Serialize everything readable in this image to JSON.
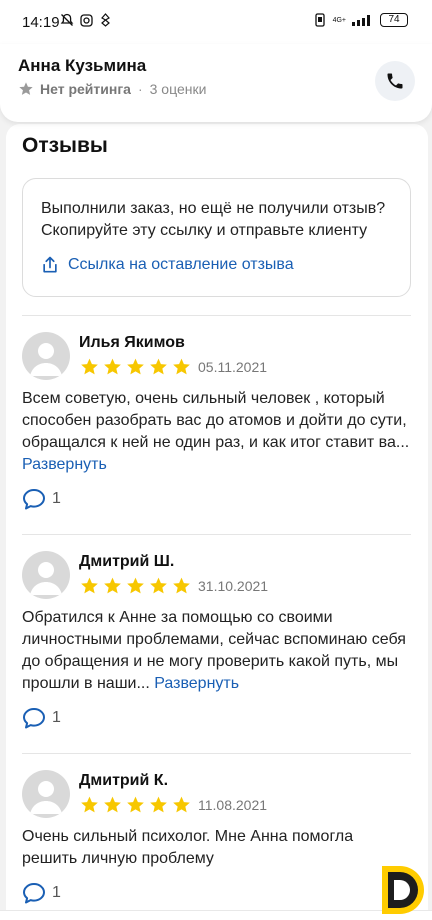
{
  "status": {
    "time": "14:19",
    "network": "4G+",
    "battery": "74"
  },
  "header": {
    "name": "Анна Кузьмина",
    "rating": "Нет рейтинга",
    "separator": "·",
    "reviews_count": "3 оценки"
  },
  "reviews_section": {
    "title": "Отзывы",
    "info_text": "Выполнили заказ, но ещё не получили отзыв? Скопируйте эту ссылку и отправьте клиенту",
    "link_label": "Ссылка на оставление отзыва"
  },
  "reviews": [
    {
      "author": "Илья Якимов",
      "stars": 5,
      "date": "05.11.2021",
      "text": "Всем советую, очень сильный человек , который способен разобрать вас до атомов и дойти до сути, обращался к ней не один раз, и как итог ставит ва...",
      "expand": "Развернуть",
      "comments": "1"
    },
    {
      "author": "Дмитрий Ш.",
      "stars": 5,
      "date": "31.10.2021",
      "text": "Обратился к Анне за помощью со своими личностными проблемами, сейчас вспоминаю себя до обращения и не могу проверить какой путь, мы прошли в наши...",
      "expand": "Развернуть",
      "comments": "1"
    },
    {
      "author": "Дмитрий К.",
      "stars": 5,
      "date": "11.08.2021",
      "text": "Очень сильный психолог. Мне Анна помогла решить личную проблему",
      "expand": "",
      "comments": "1"
    }
  ],
  "colors": {
    "accent_link": "#1a5fb4",
    "star": "#f7c700",
    "brand_yellow": "#ffcc00"
  }
}
